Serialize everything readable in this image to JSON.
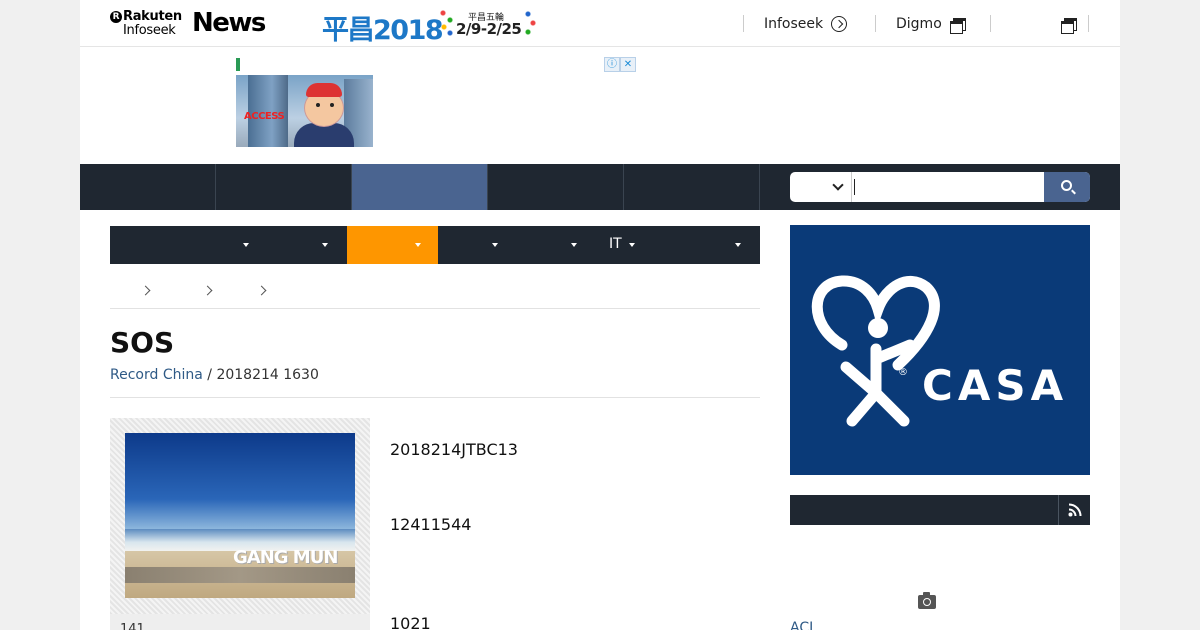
{
  "header": {
    "logo": {
      "line1": "Rakuten",
      "line2": "Infoseek",
      "news": "News"
    },
    "promo": {
      "big": "平昌2018",
      "small_top": "平昌五輪",
      "small_dates": "2/9-2/25"
    },
    "links": [
      {
        "label": "Infoseek",
        "icon": "circle-arrow-icon"
      },
      {
        "label": "Digmo",
        "icon": "window-icon"
      },
      {
        "label": "",
        "icon": "window-icon"
      }
    ]
  },
  "ad": {
    "text": "ACCESS",
    "info_label": "ⓘ",
    "close_label": "✕"
  },
  "search": {
    "placeholder": "",
    "value": ""
  },
  "category_nav": {
    "items": [
      {
        "label": ""
      },
      {
        "label": ""
      },
      {
        "label": ""
      },
      {
        "label": ""
      },
      {
        "label": ""
      },
      {
        "label": "IT"
      },
      {
        "label": ""
      }
    ],
    "active_index": 2
  },
  "article": {
    "title": "SOS",
    "source": "Record China",
    "date_sep": " / ",
    "date": "2018214 1630",
    "photo_caption": "141",
    "photo_sign": "GANG MUN",
    "paragraphs": [
      "2018214JTBC13",
      "12411544",
      "1021"
    ]
  },
  "sidebar": {
    "banner_text": "CASA",
    "banner_reg": "®",
    "link_text": "ACL"
  },
  "colors": {
    "nav_bg": "#1f2731",
    "nav_active": "#4a6490",
    "category_active": "#fe9600",
    "banner_bg": "#0a3a78",
    "link": "#2f5a86"
  }
}
